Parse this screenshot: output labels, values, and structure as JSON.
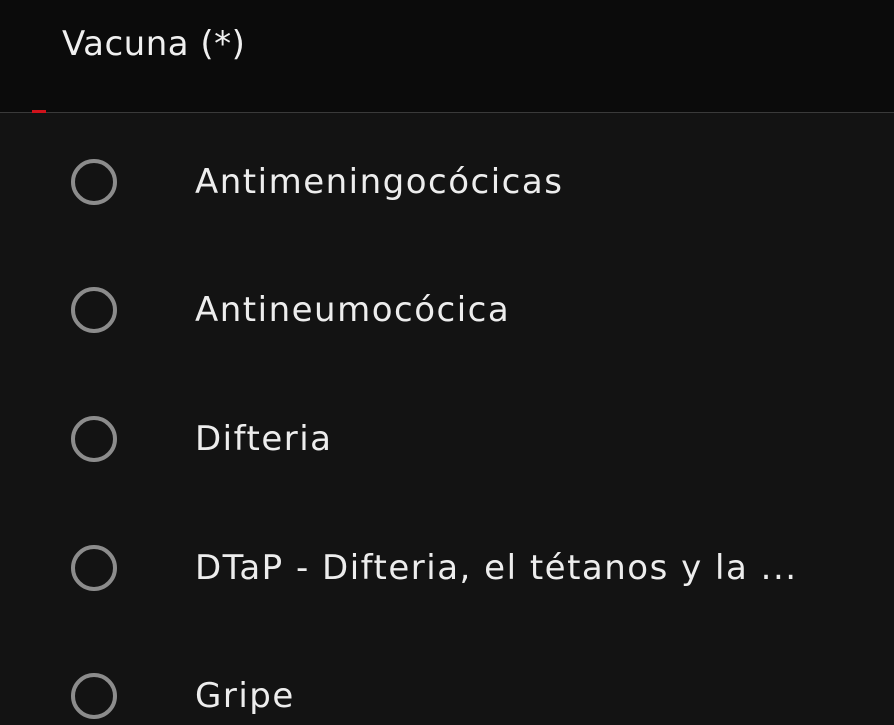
{
  "field": {
    "title": "Vacuna (*)",
    "accent_color": "#d0121b"
  },
  "options": [
    {
      "label": "Antimeningocócicas",
      "selected": false
    },
    {
      "label": "Antineumocócica",
      "selected": false
    },
    {
      "label": "Difteria",
      "selected": false
    },
    {
      "label": "DTaP - Difteria, el tétanos y la ...",
      "selected": false
    },
    {
      "label": "Gripe",
      "selected": false
    }
  ]
}
